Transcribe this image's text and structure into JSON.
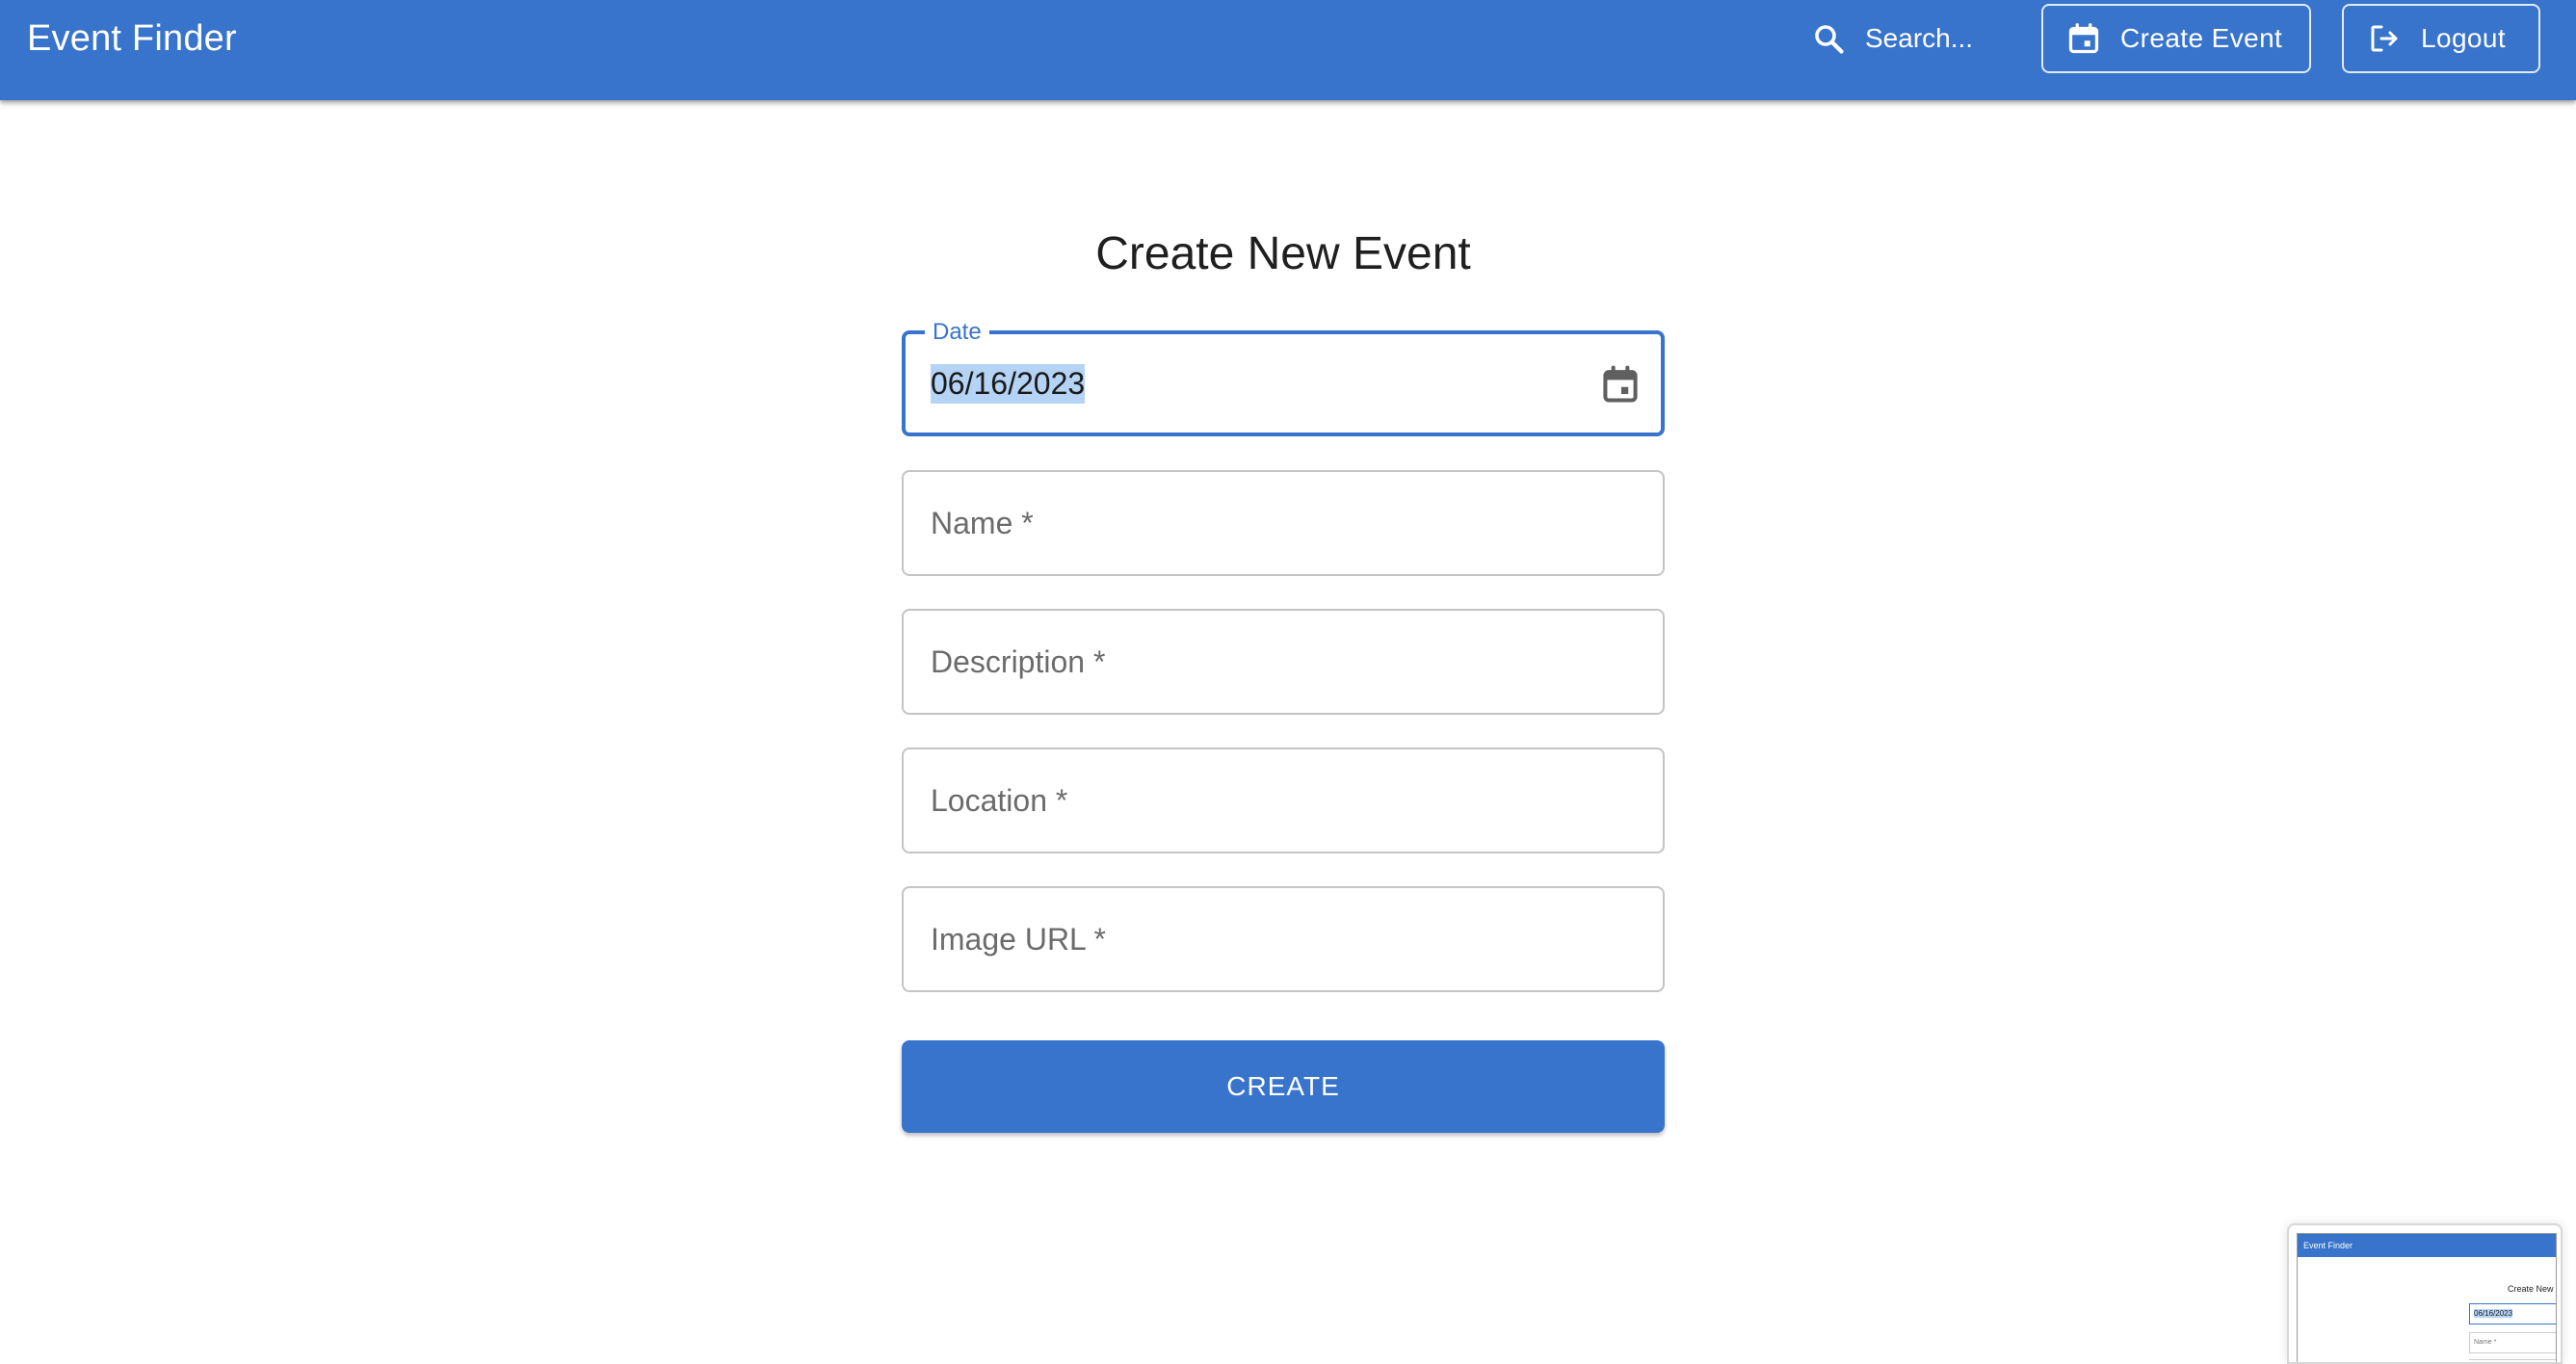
{
  "app": {
    "title": "Event Finder"
  },
  "header": {
    "search_placeholder": "Search...",
    "create_event_label": "Create Event",
    "logout_label": "Logout",
    "search_icon": "search-icon",
    "calendar_icon": "calendar-icon",
    "logout_icon": "logout-icon"
  },
  "form": {
    "title": "Create New Event",
    "fields": {
      "date": {
        "label": "Date",
        "value": "06/16/2023",
        "icon": "calendar-icon"
      },
      "name": {
        "placeholder": "Name *",
        "value": ""
      },
      "description": {
        "placeholder": "Description *",
        "value": ""
      },
      "location": {
        "placeholder": "Location *",
        "value": ""
      },
      "image_url": {
        "placeholder": "Image URL *",
        "value": ""
      }
    },
    "submit_label": "CREATE"
  },
  "preview_thumbnail": {
    "app_title": "Event Finder",
    "form_title": "Create New I",
    "date_value": "06/16/2023",
    "name_placeholder": "Name *"
  },
  "colors": {
    "primary": "#3874CB",
    "selection_highlight": "#B5D3F5",
    "field_border": "#C4C4C4"
  }
}
